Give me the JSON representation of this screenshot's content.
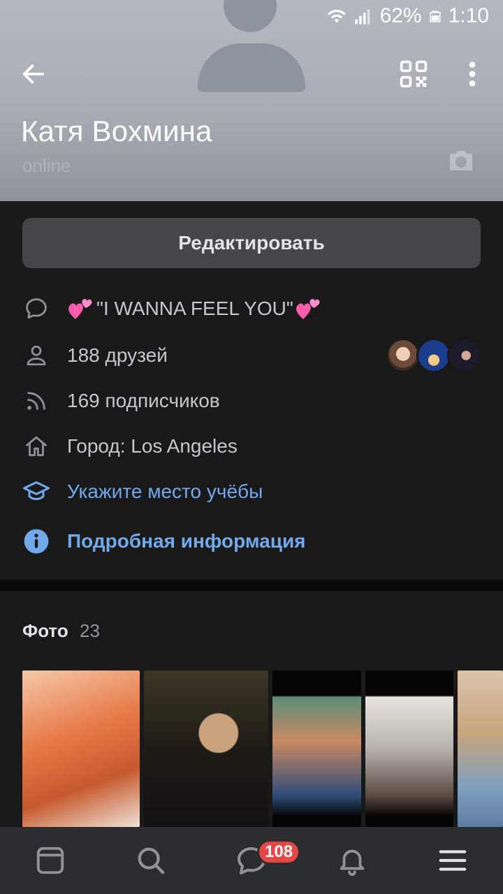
{
  "status_bar": {
    "battery": "62%",
    "time": "1:10",
    "icons": [
      "wifi-icon",
      "signal-icon",
      "battery-icon"
    ]
  },
  "header": {
    "name": "Катя Вохмина",
    "online": "online",
    "icons": [
      "back-arrow-icon",
      "qr-code-icon",
      "more-vertical-icon",
      "camera-icon"
    ]
  },
  "edit_button": "Редактировать",
  "info": {
    "status": "\"I WANNA FEEL YOU\"",
    "friends": "188 друзей",
    "followers": "169 подписчиков",
    "city": "Город: Los Angeles",
    "education_link": "Укажите место учёбы",
    "details_link": "Подробная информация"
  },
  "photos": {
    "title": "Фото",
    "count": "23"
  },
  "bottom_nav": {
    "items": [
      "feed-icon",
      "search-icon",
      "messages-icon",
      "notifications-icon",
      "menu-icon"
    ],
    "messages_badge": "108"
  },
  "colors": {
    "background": "#19191a",
    "link": "#71aaeb",
    "button": "#454647",
    "badge": "#e64646",
    "nav_bg": "#2c2d2e"
  }
}
